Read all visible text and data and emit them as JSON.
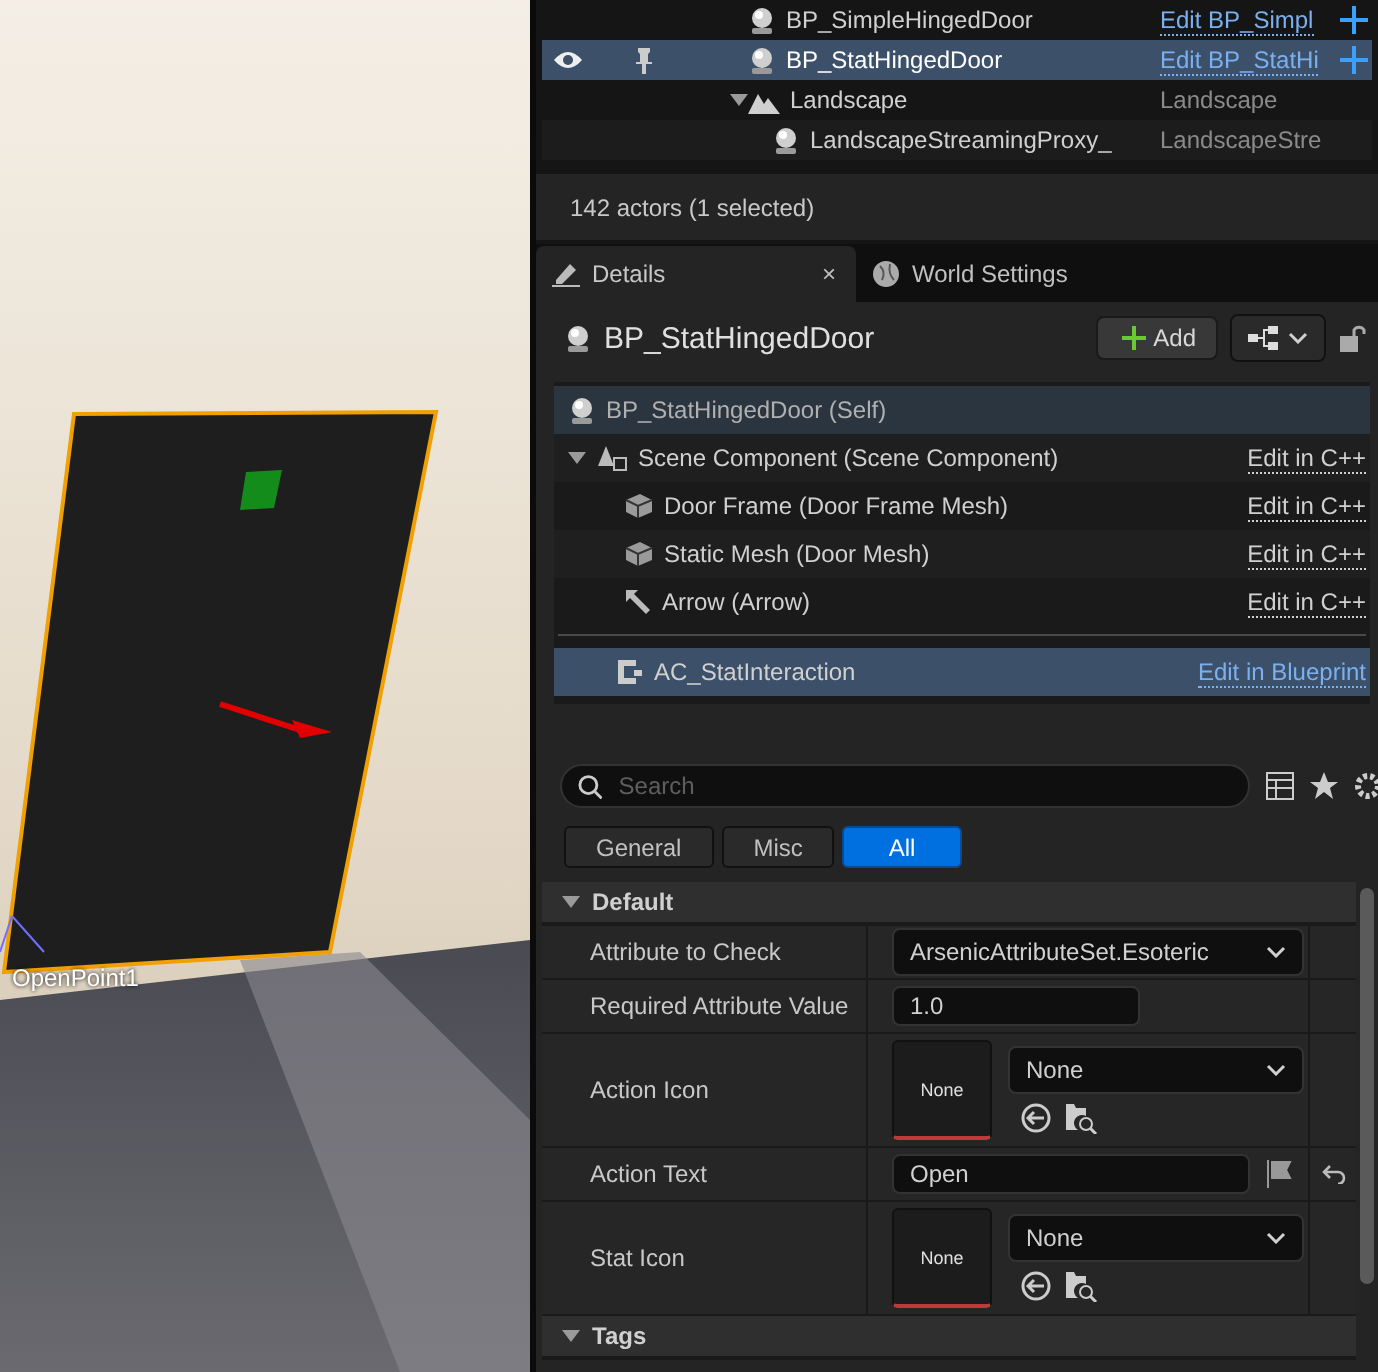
{
  "viewport": {
    "actor_label": "OpenPoint1"
  },
  "outliner": {
    "rows": [
      {
        "label": "BP_SimpleHingedDoor",
        "type": "Edit BP_Simpl",
        "kind": "blueprint",
        "selected": false,
        "visible": false,
        "pinned": false
      },
      {
        "label": "BP_StatHingedDoor",
        "type": "Edit BP_StatHi",
        "kind": "blueprint",
        "selected": true,
        "visible": true,
        "pinned": true
      },
      {
        "label": "Landscape",
        "type": "Landscape",
        "kind": "landscape",
        "selected": false,
        "visible": false,
        "pinned": false,
        "expanded": true,
        "children": [
          {
            "label": "LandscapeStreamingProxy_",
            "type": "LandscapeStre",
            "kind": "actor",
            "selected": false,
            "visible": false,
            "pinned": false
          }
        ]
      }
    ],
    "status": "142 actors (1 selected)"
  },
  "tabs": [
    {
      "label": "Details",
      "selected": true,
      "close": "×",
      "kind": "details"
    },
    {
      "label": "World Settings",
      "selected": false,
      "kind": "world"
    }
  ],
  "details": {
    "title": "BP_StatHingedDoor",
    "add_button": "Add",
    "locked": false,
    "components": [
      {
        "label": "BP_StatHingedDoor (Self)",
        "kind": "self",
        "selected": false
      },
      {
        "label": "Scene Component (Scene Component)",
        "kind": "scene",
        "edit": "Edit in C++",
        "selected": false,
        "expanded": true,
        "children": [
          {
            "label": "Door Frame (Door Frame Mesh)",
            "kind": "mesh",
            "edit": "Edit in C++",
            "selected": false
          },
          {
            "label": "Static Mesh (Door Mesh)",
            "kind": "mesh",
            "edit": "Edit in C++",
            "selected": false
          },
          {
            "label": "Arrow (Arrow)",
            "kind": "arrow",
            "edit": "Edit in C++",
            "selected": false
          }
        ]
      },
      {
        "label": "AC_StatInteraction",
        "kind": "actor_component",
        "edit": "Edit in Blueprint",
        "selected": true
      }
    ],
    "search": {
      "placeholder": "Search"
    },
    "filters": [
      {
        "label": "General",
        "selected": false
      },
      {
        "label": "Misc",
        "selected": false
      },
      {
        "label": "All",
        "selected": true
      }
    ],
    "sections": [
      {
        "title": "Default",
        "expanded": true,
        "properties": [
          {
            "label": "Attribute to Check",
            "kind": "dropdown",
            "value": "ArsenicAttributeSet.Esoteric"
          },
          {
            "label": "Required Attribute Value",
            "kind": "number",
            "value": "1.0"
          },
          {
            "label": "Action Icon",
            "kind": "asset",
            "thumbnail": "None",
            "value": "None"
          },
          {
            "label": "Action Text",
            "kind": "text",
            "value": "Open",
            "resettable": true
          },
          {
            "label": "Stat Icon",
            "kind": "asset",
            "thumbnail": "None",
            "value": "None"
          }
        ]
      },
      {
        "title": "Tags",
        "expanded": true
      }
    ]
  }
}
